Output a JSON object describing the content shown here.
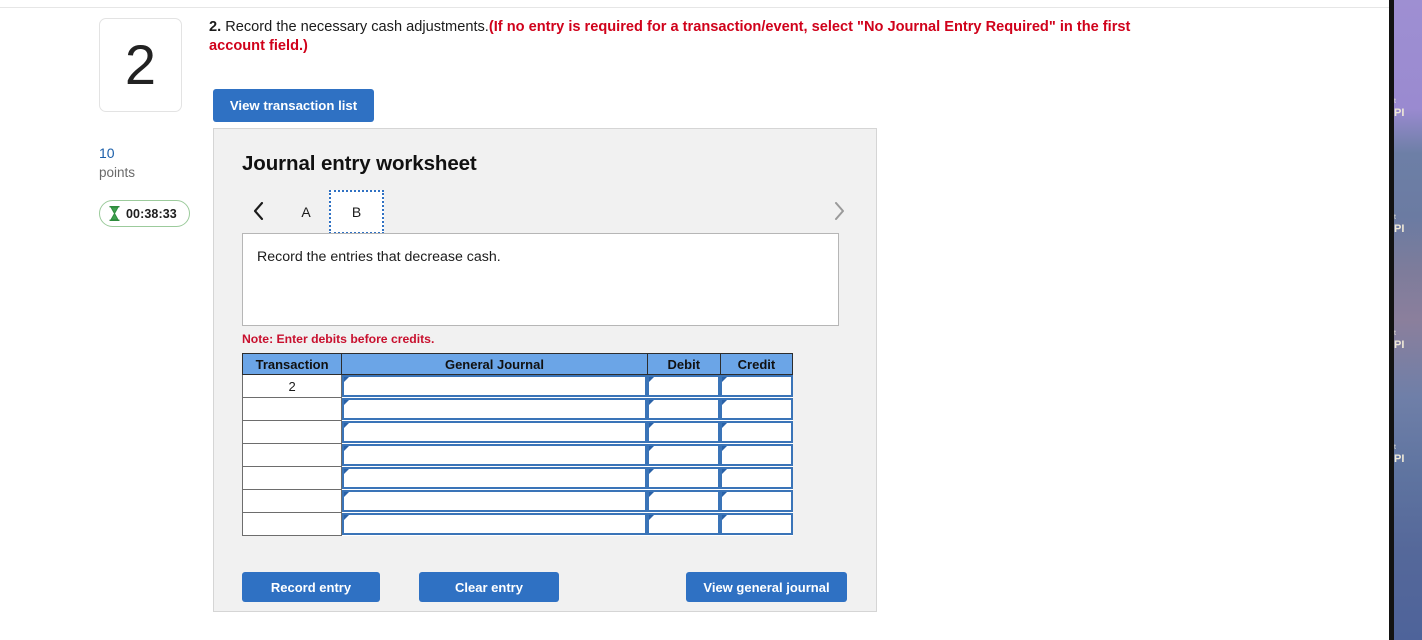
{
  "question": {
    "number": "2",
    "points_value": "10",
    "points_label": "points",
    "timer": "00:38:33",
    "timer_icon": "hourglass-icon",
    "prompt_number": "2.",
    "prompt_text": " Record the necessary cash adjustments.",
    "prompt_emphasis": "(If no entry is required for a transaction/event, select \"No Journal Entry Required\" in the first account field.)",
    "view_transaction_list_label": "View transaction list"
  },
  "worksheet": {
    "title": "Journal entry worksheet",
    "prev_icon": "chevron-left-icon",
    "next_icon": "chevron-right-icon",
    "tabs": [
      {
        "label": "A",
        "selected": false
      },
      {
        "label": "B",
        "selected": true
      }
    ],
    "prompt": "Record the entries that decrease cash.",
    "note": "Note: Enter debits before credits.",
    "table": {
      "headers": [
        "Transaction",
        "General Journal",
        "Debit",
        "Credit"
      ],
      "rows": [
        {
          "transaction": "2",
          "general_journal": "",
          "debit": "",
          "credit": ""
        },
        {
          "transaction": "",
          "general_journal": "",
          "debit": "",
          "credit": ""
        },
        {
          "transaction": "",
          "general_journal": "",
          "debit": "",
          "credit": ""
        },
        {
          "transaction": "",
          "general_journal": "",
          "debit": "",
          "credit": ""
        },
        {
          "transaction": "",
          "general_journal": "",
          "debit": "",
          "credit": ""
        },
        {
          "transaction": "",
          "general_journal": "",
          "debit": "",
          "credit": ""
        },
        {
          "transaction": "",
          "general_journal": "",
          "debit": "",
          "credit": ""
        }
      ]
    },
    "actions": {
      "record_entry": "Record entry",
      "clear_entry": "Clear entry",
      "view_general_journal": "View general journal"
    }
  },
  "right_panel": {
    "items": [
      {
        "tiny": "t",
        "label": "PI"
      },
      {
        "tiny": "t",
        "label": "PI"
      },
      {
        "tiny": "t",
        "label": "PI"
      },
      {
        "tiny": "t",
        "label": "PI"
      }
    ]
  },
  "colors": {
    "button_blue": "#2f71c3",
    "table_header_blue": "#6ba5e7",
    "input_border_blue": "#3a74b8",
    "alert_red": "#d0021b",
    "note_red": "#c8102e",
    "points_blue": "#1b5faa",
    "timer_green": "#2e8b3d",
    "panel_bg": "#f1f1f1"
  }
}
